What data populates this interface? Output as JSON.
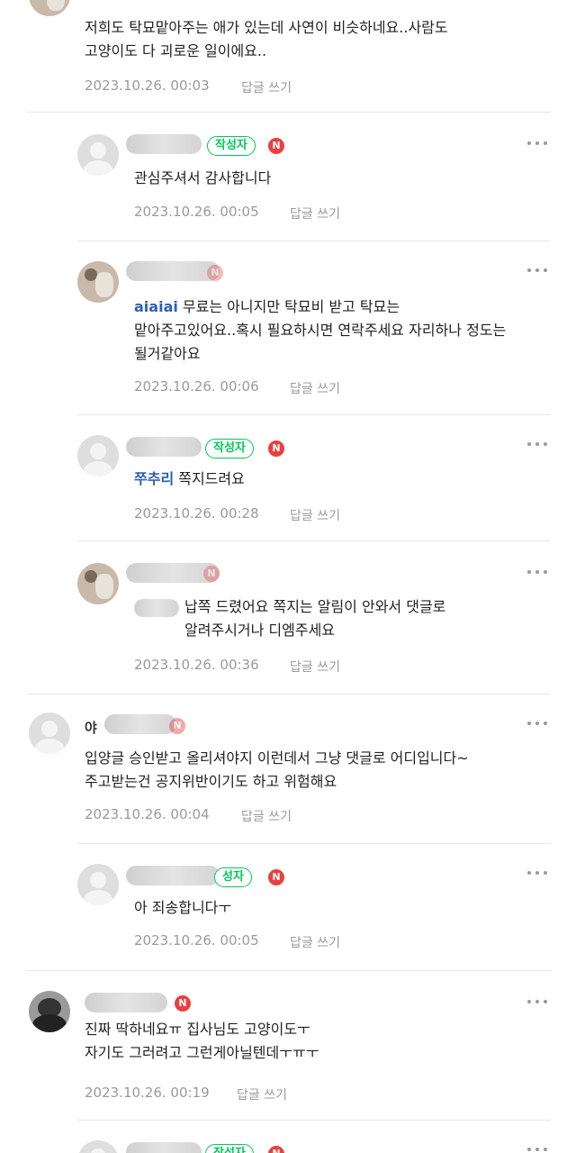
{
  "comments": [
    {
      "nick": "",
      "text": "저희도 탁묘맡아주는 애가 있는데 사연이 비슷하네요..사람도\n고양이도 다 괴로운 일이에요..",
      "date": "2023.10.26. 00:03",
      "reply": "답글 쓰기"
    },
    {
      "nick": "",
      "badge": "작성자",
      "n": "N",
      "text": "관심주셔서 감사합니다",
      "date": "2023.10.26. 00:05",
      "reply": "답글 쓰기"
    },
    {
      "nick": "",
      "n": "N",
      "mention": "aiaiai",
      "text": " 무료는 아니지만 탁묘비 받고 탁묘는\n맡아주고있어요..혹시 필요하시면 연락주세요 자리하나 정도는\n될거같아요",
      "date": "2023.10.26. 00:06",
      "reply": "답글 쓰기"
    },
    {
      "nick": "",
      "badge": "작성자",
      "n": "N",
      "mention": "쭈추리",
      "text": " 쪽지드려요",
      "date": "2023.10.26. 00:28",
      "reply": "답글 쓰기"
    },
    {
      "nick": "",
      "n": "N",
      "mention": "",
      "text": "납쪽 드렸어요 쪽지는 알림이 안와서 댓글로\n알려주시거나 디엠주세요",
      "date": "2023.10.26. 00:36",
      "reply": "답글 쓰기"
    },
    {
      "nick": "야",
      "n": "N",
      "text": "입양글 승인받고 올리셔야지 이런데서 그냥 댓글로 어디입니다~\n주고받는건 공지위반이기도 하고 위험해요",
      "date": "2023.10.26. 00:04",
      "reply": "답글 쓰기"
    },
    {
      "nick": "",
      "badge": "성자",
      "n": "N",
      "text": "아 죄송합니다ㅜ",
      "date": "2023.10.26. 00:05",
      "reply": "답글 쓰기"
    },
    {
      "nick": "",
      "n": "N",
      "text": "진짜 딱하네요ㅠ 집사님도 고양이도ㅜ\n자기도 그러려고 그런게아닐텐데ㅜㅠㅜ",
      "date": "2023.10.26. 00:19",
      "reply": "답글 쓰기"
    },
    {
      "nick": "",
      "badge": "작성자",
      "n": "N"
    }
  ],
  "colors": {
    "writer_badge": "#03c75a",
    "n_badge": "#e8413e",
    "mention": "#2d5fb8",
    "meta": "#9a9a9a"
  },
  "icons": {
    "more": "more-dots-icon",
    "avatar": "default-avatar-icon"
  }
}
